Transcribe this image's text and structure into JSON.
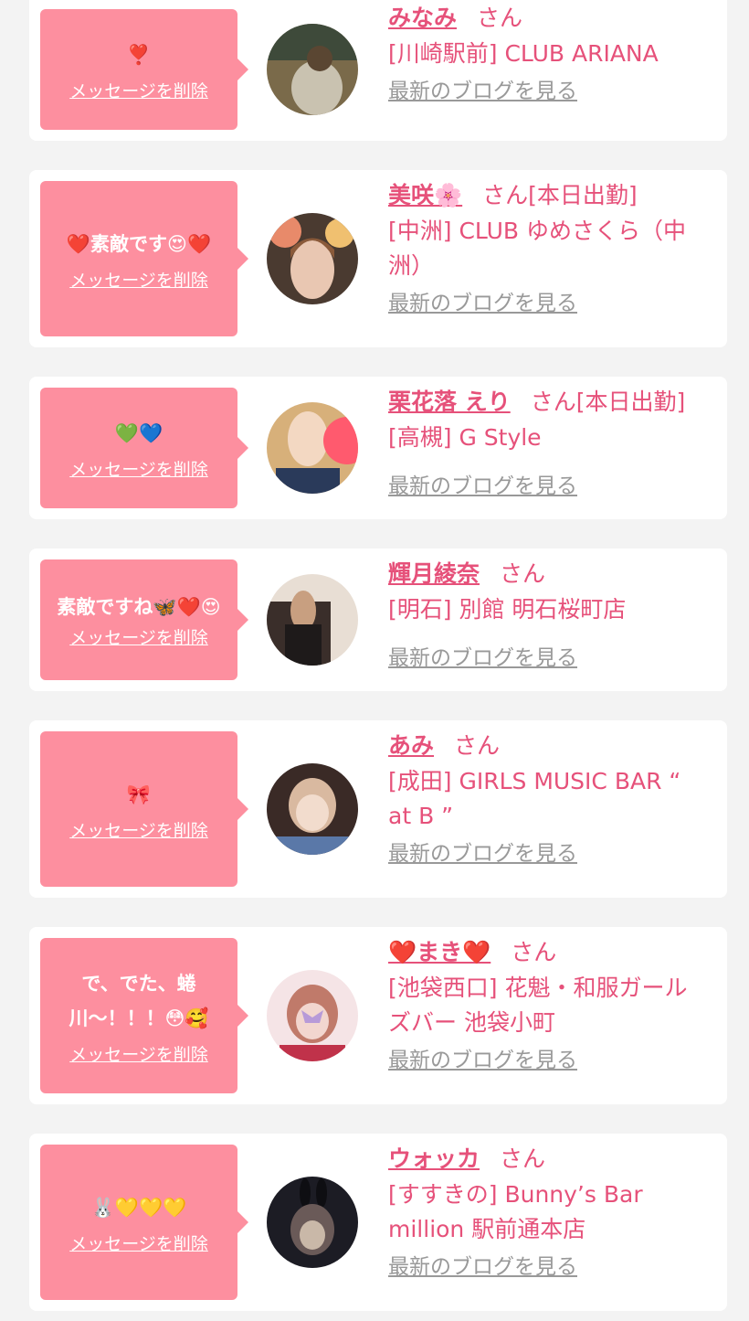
{
  "messages": [
    {
      "bubble_text": "❣️",
      "delete_label": "メッセージを削除",
      "name": "みなみ",
      "suffix": "さん",
      "shop": "[川崎駅前] CLUB ARIANA",
      "blog_label": "最新のブログを見る",
      "avatar_colors": [
        "#7a6a4a",
        "#c9c2b0",
        "#3e4a3a"
      ]
    },
    {
      "bubble_text": "❤️素敵です😍❤️",
      "delete_label": "メッセージを削除",
      "name": "美咲🌸",
      "suffix": "さん[本日出勤]",
      "shop": "[中洲] CLUB ゆめさくら（中洲）",
      "blog_label": "最新のブログを見る",
      "avatar_colors": [
        "#c87a5a",
        "#e9c7b2",
        "#4a3a30"
      ]
    },
    {
      "bubble_text": "💚💙",
      "delete_label": "メッセージを削除",
      "name": "栗花落 えり",
      "suffix": "さん[本日出勤]",
      "shop": "[高槻] G Style",
      "blog_label": "最新のブログを見る",
      "avatar_colors": [
        "#d7b07a",
        "#f3d8c2",
        "#ff5a6e"
      ]
    },
    {
      "bubble_text": "素敵ですね🦋❤️😍",
      "delete_label": "メッセージを削除",
      "name": "輝月綾奈",
      "suffix": "さん",
      "shop": "[明石] 別館 明石桜町店",
      "blog_label": "最新のブログを見る",
      "avatar_colors": [
        "#3a2e2a",
        "#c89f80",
        "#e8ded4"
      ]
    },
    {
      "bubble_text": "🎀",
      "delete_label": "メッセージを削除",
      "name": "あみ",
      "suffix": "さん",
      "shop": "[成田] GIRLS MUSIC BAR “ at B ”",
      "blog_label": "最新のブログを見る",
      "avatar_colors": [
        "#d9b9a0",
        "#f2dccd",
        "#5a78a8"
      ]
    },
    {
      "bubble_text": "で、でた、蜷川〜！！！😳🥰",
      "delete_label": "メッセージを削除",
      "name": "❤️まき❤️",
      "suffix": "さん",
      "shop": "[池袋西口] 花魁・和服ガールズバー 池袋小町",
      "blog_label": "最新のブログを見る",
      "avatar_colors": [
        "#e8b8c0",
        "#f5e4e6",
        "#c0324a"
      ]
    },
    {
      "bubble_text": "🐰💛💛💛",
      "delete_label": "メッセージを削除",
      "name": "ウォッカ",
      "suffix": "さん",
      "shop": "[すすきの] Bunny’s Bar million 駅前通本店",
      "blog_label": "最新のブログを見る",
      "avatar_colors": [
        "#1c1c24",
        "#6a5a58",
        "#c9b8a8"
      ]
    }
  ]
}
